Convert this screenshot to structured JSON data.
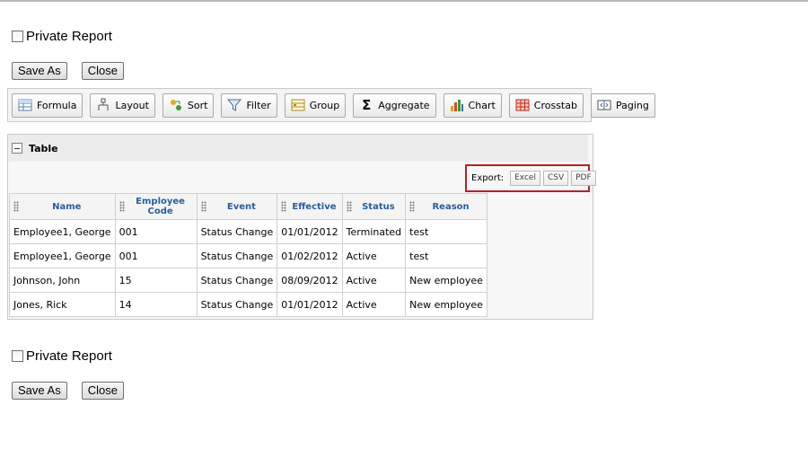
{
  "top_section": {
    "private_report_label": "Private Report",
    "save_as_label": "Save As",
    "close_label": "Close"
  },
  "toolbar": {
    "buttons": [
      {
        "label": "Formula",
        "icon": "formula-icon"
      },
      {
        "label": "Layout",
        "icon": "layout-icon"
      },
      {
        "label": "Sort",
        "icon": "sort-icon"
      },
      {
        "label": "Filter",
        "icon": "filter-icon"
      },
      {
        "label": "Group",
        "icon": "group-icon"
      },
      {
        "label": "Aggregate",
        "icon": "sigma-icon"
      },
      {
        "label": "Chart",
        "icon": "bar-chart-icon"
      },
      {
        "label": "Crosstab",
        "icon": "crosstab-icon"
      },
      {
        "label": "Paging",
        "icon": "paging-icon"
      }
    ]
  },
  "table_panel": {
    "title": "Table",
    "export": {
      "label": "Export:",
      "excel": "Excel",
      "csv": "CSV",
      "pdf": "PDF"
    },
    "columns": [
      "Name",
      "Employee Code",
      "Event",
      "Effective",
      "Status",
      "Reason"
    ],
    "rows": [
      [
        "Employee1, George",
        "001",
        "Status Change",
        "01/01/2012",
        "Terminated",
        "test"
      ],
      [
        "Employee1, George",
        "001",
        "Status Change",
        "01/02/2012",
        "Active",
        "test"
      ],
      [
        "Johnson, John",
        "15",
        "Status Change",
        "08/09/2012",
        "Active",
        "New employee"
      ],
      [
        "Jones, Rick",
        "14",
        "Status Change",
        "01/01/2012",
        "Active",
        "New employee"
      ]
    ]
  },
  "bottom_section": {
    "private_report_label": "Private Report",
    "save_as_label": "Save As",
    "close_label": "Close"
  },
  "colors": {
    "header_text": "#2a5d9c",
    "export_highlight": "#b12427"
  }
}
